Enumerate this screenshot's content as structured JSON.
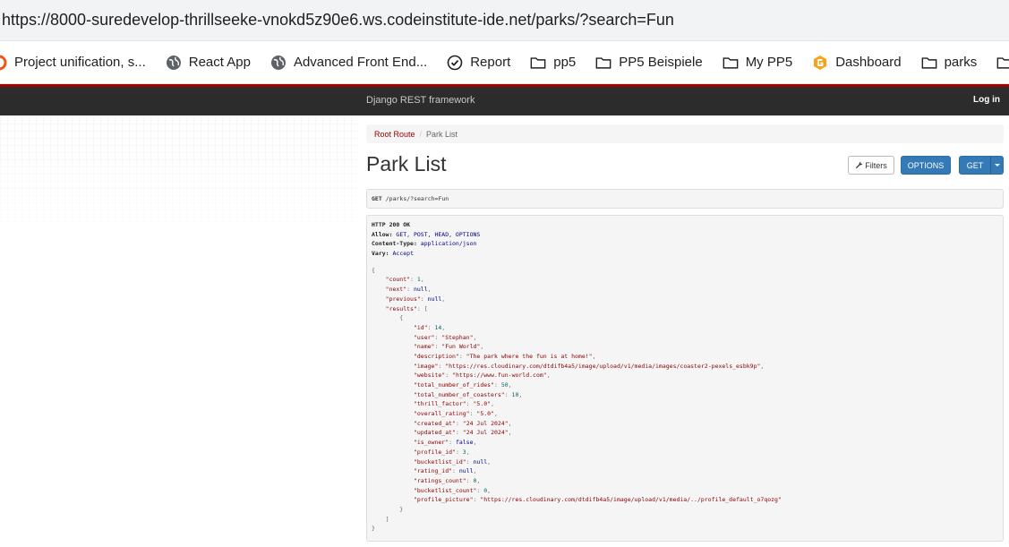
{
  "browser": {
    "url": "https://8000-suredevelop-thrillseeke-vnokd5z90e6.ws.codeinstitute-ide.net/parks/?search=Fun",
    "bookmarks": [
      {
        "label": "Project unification, s...",
        "icon": "orange-circle-icon"
      },
      {
        "label": "React App",
        "icon": "globe-icon"
      },
      {
        "label": "Advanced Front End...",
        "icon": "globe-icon"
      },
      {
        "label": "Report",
        "icon": "check-circle-icon"
      },
      {
        "label": "pp5",
        "icon": "folder-icon"
      },
      {
        "label": "PP5 Beispiele",
        "icon": "folder-icon"
      },
      {
        "label": "My PP5",
        "icon": "folder-icon"
      },
      {
        "label": "Dashboard",
        "icon": "orange-logo-icon"
      },
      {
        "label": "parks",
        "icon": "folder-icon"
      }
    ]
  },
  "navbar": {
    "brand": "Django REST framework",
    "login": "Log in"
  },
  "breadcrumb": {
    "root": "Root Route",
    "separator": "/",
    "current": "Park List"
  },
  "page": {
    "title": "Park List",
    "filters_label": "Filters",
    "options_label": "OPTIONS",
    "get_label": "GET"
  },
  "request": {
    "method": "GET",
    "path": "/parks/?search=Fun"
  },
  "response": {
    "status": "HTTP 200 OK",
    "headers": [
      {
        "name": "Allow:",
        "value": "GET, POST, HEAD, OPTIONS"
      },
      {
        "name": "Content-Type:",
        "value": "application/json"
      },
      {
        "name": "Vary:",
        "value": "Accept"
      }
    ],
    "body": {
      "count": "1",
      "next": "null",
      "previous": "null",
      "result": [
        {
          "key": "id",
          "value": "14",
          "type": "n"
        },
        {
          "key": "user",
          "value": "Stephan",
          "type": "s"
        },
        {
          "key": "name",
          "value": "Fun World",
          "type": "s"
        },
        {
          "key": "description",
          "value": "The park where the fun is at home!",
          "type": "s"
        },
        {
          "key": "image",
          "value": "https://res.cloudinary.com/dtdifb4a5/image/upload/v1/media/images/coaster2-pexels_esbk9p",
          "type": "s"
        },
        {
          "key": "website",
          "value": "https://www.fun-world.com",
          "type": "s"
        },
        {
          "key": "total_number_of_rides",
          "value": "50",
          "type": "n"
        },
        {
          "key": "total_number_of_coasters",
          "value": "10",
          "type": "n"
        },
        {
          "key": "thrill_factor",
          "value": "5.0",
          "type": "s"
        },
        {
          "key": "overall_rating",
          "value": "5.0",
          "type": "s"
        },
        {
          "key": "created_at",
          "value": "24 Jul 2024",
          "type": "s"
        },
        {
          "key": "updated_at",
          "value": "24 Jul 2024",
          "type": "s"
        },
        {
          "key": "is_owner",
          "value": "false",
          "type": "lit"
        },
        {
          "key": "profile_id",
          "value": "3",
          "type": "n"
        },
        {
          "key": "bucketlist_id",
          "value": "null",
          "type": "lit"
        },
        {
          "key": "rating_id",
          "value": "null",
          "type": "lit"
        },
        {
          "key": "ratings_count",
          "value": "0",
          "type": "n"
        },
        {
          "key": "bucketlist_count",
          "value": "0",
          "type": "n"
        },
        {
          "key": "profile_picture",
          "value": "https://res.cloudinary.com/dtdifb4a5/image/upload/v1/media/../profile_default_o7qozg",
          "type": "s"
        }
      ]
    }
  },
  "colors": {
    "drf_red": "#a30000",
    "navbar_bg": "#2c2c2c",
    "button_blue": "#337ab7"
  }
}
